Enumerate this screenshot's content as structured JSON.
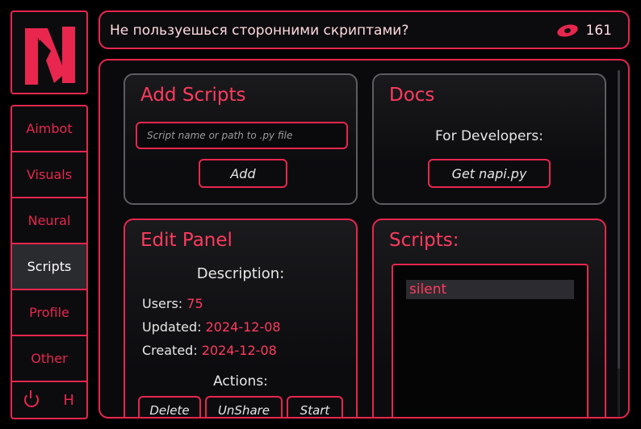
{
  "logo": {
    "icon": "n-logo-icon",
    "accent": "#e8264e"
  },
  "nav": {
    "items": [
      {
        "label": "Aimbot",
        "active": false
      },
      {
        "label": "Visuals",
        "active": false
      },
      {
        "label": "Neural",
        "active": false
      },
      {
        "label": "Scripts",
        "active": true
      },
      {
        "label": "Profile",
        "active": false
      },
      {
        "label": "Other",
        "active": false
      }
    ],
    "bottom": {
      "power_icon": "power-icon",
      "hotkey": "H"
    }
  },
  "header": {
    "title": "Не пользуешься сторонними скриптами?",
    "eye_icon": "eye-icon",
    "count": "161"
  },
  "add_scripts": {
    "title": "Add Scripts",
    "input_placeholder": "Script name or path to .py file",
    "input_value": "",
    "button": "Add"
  },
  "docs": {
    "title": "Docs",
    "subtitle": "For Developers:",
    "button": "Get napi.py"
  },
  "edit_panel": {
    "title": "Edit Panel",
    "description_label": "Description:",
    "users_label": "Users:",
    "users_value": "75",
    "updated_label": "Updated:",
    "updated_value": "2024-12-08",
    "created_label": "Created:",
    "created_value": "2024-12-08",
    "actions_label": "Actions:",
    "buttons": [
      "Delete",
      "UnShare",
      "Start"
    ]
  },
  "scripts": {
    "title": "Scripts:",
    "items": [
      "silent"
    ]
  },
  "colors": {
    "accent": "#e8264e",
    "accent_text": "#ff3b5e",
    "background": "#0b0b0d",
    "active_nav": "#2a2b2f"
  }
}
